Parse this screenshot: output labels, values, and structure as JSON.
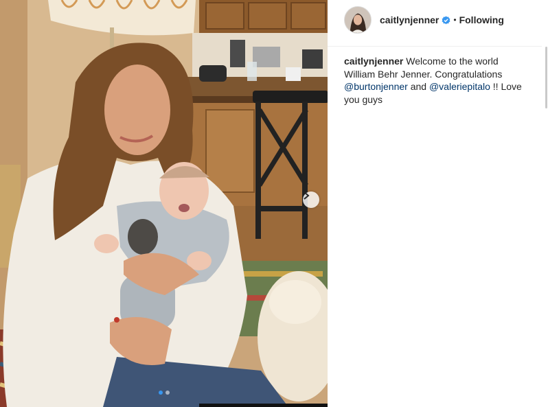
{
  "post": {
    "username": "caitlynjenner",
    "separator": "•",
    "follow_state": "Following",
    "verified_icon": "verified-badge-icon",
    "caption": {
      "username": "caitlynjenner",
      "text_1": "Welcome to the world William Behr Jenner. Congratulations",
      "mention_1": "@burtonjenner",
      "text_2": "and",
      "mention_2": "@valeriepitalo",
      "text_3": "!! Love you guys"
    }
  },
  "carousel": {
    "current_index": 1,
    "total": 2,
    "next_icon": "chevron-right-icon"
  },
  "colors": {
    "verified": "#3897f0",
    "mention": "#003569",
    "active_dot": "#3897f0",
    "text": "#262626"
  }
}
